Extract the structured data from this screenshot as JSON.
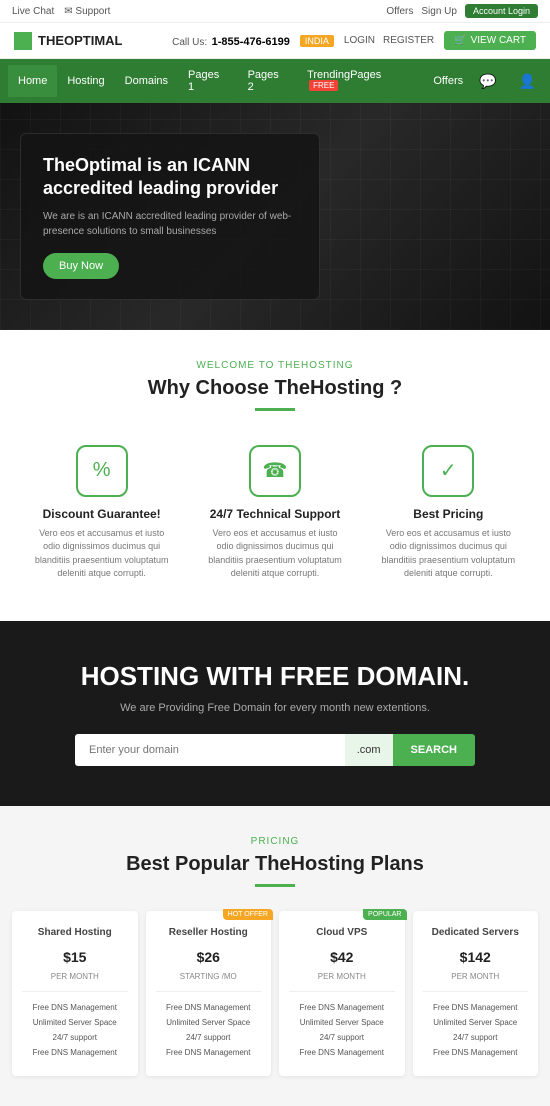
{
  "topbar": {
    "live_chat": "Live Chat",
    "support": "Support",
    "offers": "Offers",
    "sign_up": "Sign Up",
    "account_login": "Account Login"
  },
  "header": {
    "logo_text": "THEOPTIMAL",
    "phone_label": "Call Us:",
    "phone": "1-855-476-6199",
    "india": "INDIA",
    "login": "LOGIN",
    "register": "REGISTER",
    "view_cart": "VIEW CART"
  },
  "nav": {
    "items": [
      {
        "label": "Home",
        "active": true,
        "badge": ""
      },
      {
        "label": "Hosting",
        "active": false,
        "badge": ""
      },
      {
        "label": "Domains",
        "active": false,
        "badge": ""
      },
      {
        "label": "Pages 1",
        "active": false,
        "badge": ""
      },
      {
        "label": "Pages 2",
        "active": false,
        "badge": ""
      },
      {
        "label": "TrendingPages",
        "active": false,
        "badge": "FREE"
      },
      {
        "label": "Offers",
        "active": false,
        "badge": ""
      }
    ]
  },
  "hero": {
    "title": "TheOptimal is an ICANN accredited leading provider",
    "description": "We are is an ICANN accredited leading provider of web-presence solutions to small businesses",
    "cta": "Buy Now"
  },
  "why": {
    "pre_title": "WELCOME TO THEHOSTING",
    "title": "Why Choose TheHosting ?",
    "features": [
      {
        "icon": "%",
        "title": "Discount Guarantee!",
        "description": "Vero eos et accusamus et iusto odio dignissimos ducimus qui blanditiis praesentium voluptatum deleniti atque corrupti."
      },
      {
        "icon": "☎",
        "title": "24/7 Technical Support",
        "description": "Vero eos et accusamus et iusto odio dignissimos ducimus qui blanditiis praesentium voluptatum deleniti atque corrupti."
      },
      {
        "icon": "✓",
        "title": "Best Pricing",
        "description": "Vero eos et accusamus et iusto odio dignissimos ducimus qui blanditiis praesentium voluptatum deleniti atque corrupti."
      }
    ]
  },
  "domain": {
    "title": "HOSTING WITH FREE DOMAIN.",
    "description": "We are Providing Free Domain for every month new extentions.",
    "input_placeholder": "Enter your domain",
    "ext": ".com",
    "search_btn": "SEARCH"
  },
  "pricing": {
    "pre_title": "PRICING",
    "title": "Best Popular TheHosting Plans",
    "cards": [
      {
        "title": "Shared Hosting",
        "currency": "$",
        "price": "15",
        "period": "PER MONTH",
        "badge": "",
        "starting": "",
        "features": [
          "Free DNS Management",
          "Unlimited Server Space",
          "24/7 support",
          "Free DNS Management"
        ]
      },
      {
        "title": "Reseller Hosting",
        "currency": "$",
        "price": "26",
        "period": "STARTING /mo",
        "badge": "HOT OFFER",
        "starting": "STARTING /mo",
        "features": [
          "Free DNS Management",
          "Unlimited Server Space",
          "24/7 support",
          "Free DNS Management"
        ]
      },
      {
        "title": "Cloud VPS",
        "currency": "$",
        "price": "42",
        "period": "PER MONTH",
        "badge": "POPULAR",
        "starting": "",
        "features": [
          "Free DNS Management",
          "Unlimited Server Space",
          "24/7 support",
          "Free DNS Management"
        ]
      },
      {
        "title": "Dedicated Servers",
        "currency": "$",
        "price": "142",
        "period": "PER MONTH",
        "badge": "",
        "starting": "",
        "features": [
          "Free DNS Management",
          "Unlimited Server Space",
          "24/7 support",
          "Free DNS Management"
        ]
      }
    ]
  }
}
